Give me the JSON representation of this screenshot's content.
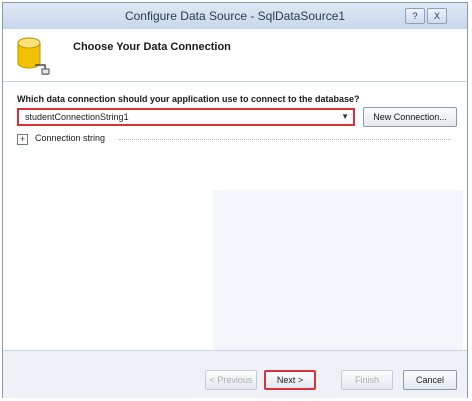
{
  "window": {
    "title": "Configure Data Source - SqlDataSource1",
    "help_button": "?",
    "close_button": "X"
  },
  "header": {
    "title": "Choose Your Data Connection",
    "icon": "database-connection-icon"
  },
  "main": {
    "question": "Which data connection should your application use to connect to the database?",
    "connection_select": {
      "value": "studentConnectionString1"
    },
    "new_connection_label": "New Connection...",
    "connection_string_label": "Connection string",
    "expander_symbol": "+"
  },
  "footer": {
    "previous_label": "< Previous",
    "next_label": "Next >",
    "finish_label": "Finish",
    "cancel_label": "Cancel"
  },
  "colors": {
    "highlight": "#d9303a",
    "titlebar": "#c7d7ea",
    "database_icon": "#f2c200"
  }
}
